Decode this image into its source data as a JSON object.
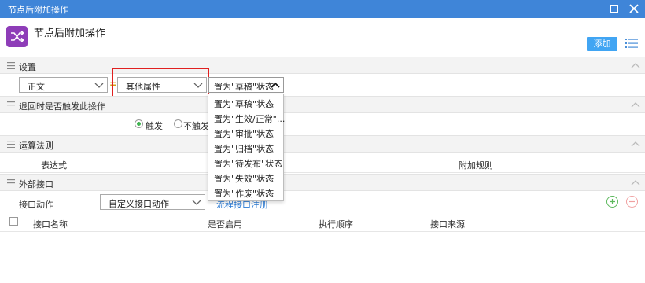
{
  "window": {
    "title": "节点后附加操作"
  },
  "header": {
    "title": "节点后附加操作",
    "add_label": "添加"
  },
  "sections": {
    "settings": "设置",
    "return_trigger": "退回时是否触发此操作",
    "rules": "运算法则",
    "external": "外部接口"
  },
  "settings": {
    "field_select": "正文",
    "equals": "=",
    "attr_select": "其他属性",
    "status_select": "置为\"草稿\"状态"
  },
  "status_dropdown": {
    "options": [
      "置为\"草稿\"状态",
      "置为\"生效/正常\"...",
      "置为\"审批\"状态",
      "置为\"归档\"状态",
      "置为\"待发布\"状态",
      "置为\"失效\"状态",
      "置为\"作废\"状态"
    ]
  },
  "return_trigger": {
    "options": [
      {
        "label": "触发",
        "checked": true
      },
      {
        "label": "不触发",
        "checked": false
      }
    ]
  },
  "rules_table": {
    "columns": [
      "表达式",
      "附加规则"
    ]
  },
  "external": {
    "action_label": "接口动作",
    "action_select": "自定义接口动作",
    "register_link": "流程接口注册",
    "columns": [
      "接口名称",
      "是否启用",
      "执行顺序",
      "接口来源"
    ]
  },
  "colors": {
    "titlebar": "#3f85d8",
    "accent": "#41a5f3",
    "icon_bg": "#8e3db8",
    "highlight": "#e02020"
  }
}
